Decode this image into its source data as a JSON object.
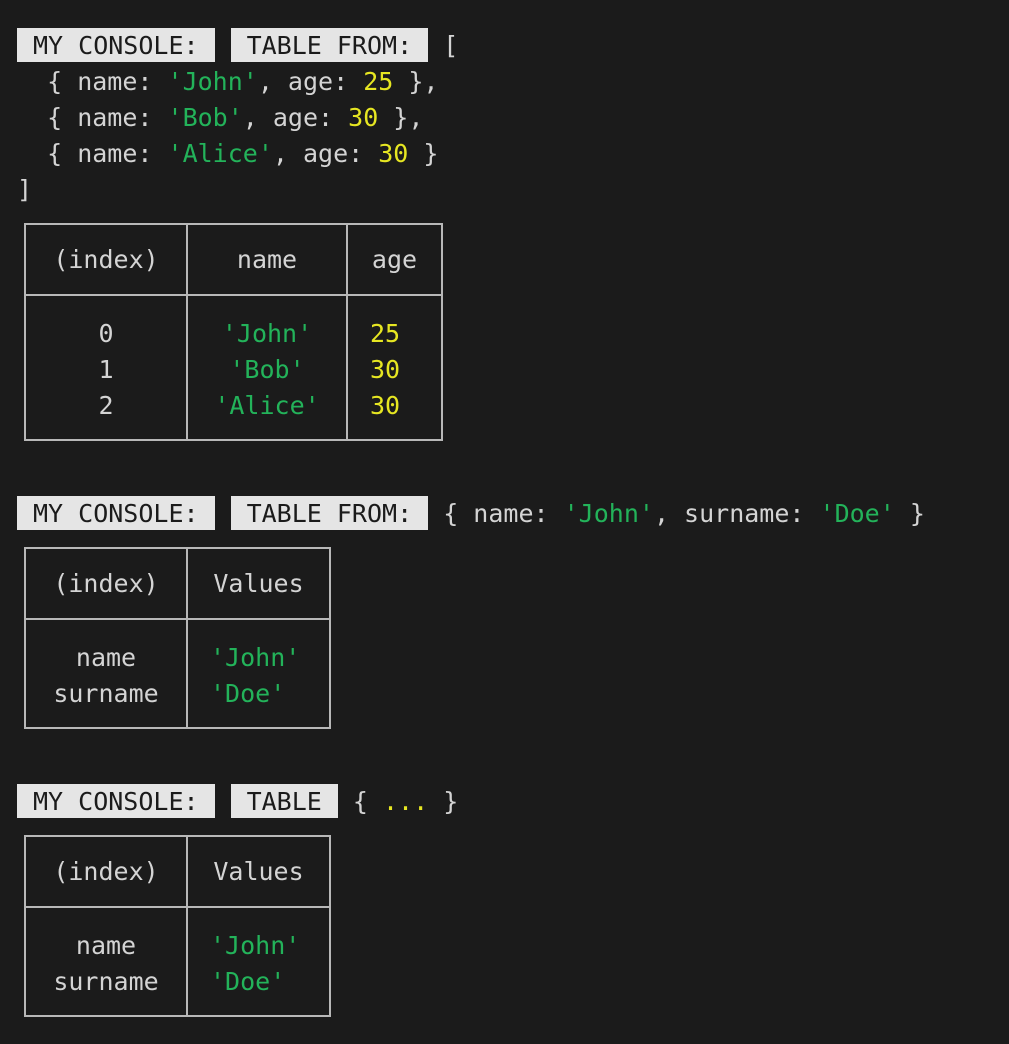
{
  "labels": {
    "console": "MY CONSOLE:",
    "table_from": "TABLE FROM:",
    "table": "TABLE"
  },
  "log1": {
    "open": "[",
    "close": "]",
    "rows": [
      {
        "name": "'John'",
        "age": "25"
      },
      {
        "name": "'Bob'",
        "age": "30"
      },
      {
        "name": "'Alice'",
        "age": "30"
      }
    ]
  },
  "table1": {
    "headers": [
      "(index)",
      "name",
      "age"
    ],
    "index": [
      "0",
      "1",
      "2"
    ],
    "names": [
      "'John'",
      "'Bob'",
      "'Alice'"
    ],
    "ages": [
      "25",
      "30",
      "30"
    ]
  },
  "log2": {
    "name_value": "'John'",
    "surname_value": "'Doe'"
  },
  "table2": {
    "headers": [
      "(index)",
      "Values"
    ],
    "index": [
      "name",
      "surname"
    ],
    "values": [
      "'John'",
      "'Doe'"
    ]
  },
  "log3": {
    "ellipsis": "..."
  },
  "table3": {
    "headers": [
      "(index)",
      "Values"
    ],
    "index": [
      "name",
      "surname"
    ],
    "values": [
      "'John'",
      "'Doe'"
    ]
  },
  "colors": {
    "background": "#1b1b1b",
    "text": "#d4d4d4",
    "string": "#23b35a",
    "number": "#e6e622",
    "badge_bg": "#e5e5e5",
    "border": "#b8b8b8"
  }
}
